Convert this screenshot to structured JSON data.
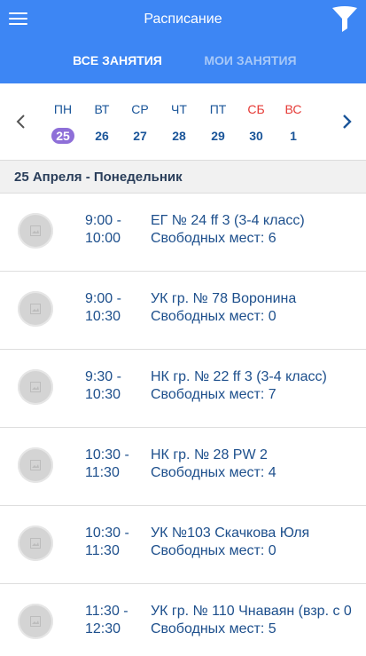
{
  "header": {
    "title": "Расписание",
    "menu_icon": "hamburger-menu-icon",
    "filter_icon": "funnel-filter-icon"
  },
  "tabs": [
    {
      "label": "ВСЕ ЗАНЯТИЯ",
      "active": true
    },
    {
      "label": "МОИ ЗАНЯТИЯ",
      "active": false
    }
  ],
  "week": {
    "days": [
      {
        "name": "ПН",
        "num": "25",
        "selected": true,
        "weekend": false
      },
      {
        "name": "ВТ",
        "num": "26",
        "selected": false,
        "weekend": false
      },
      {
        "name": "СР",
        "num": "27",
        "selected": false,
        "weekend": false
      },
      {
        "name": "ЧТ",
        "num": "28",
        "selected": false,
        "weekend": false
      },
      {
        "name": "ПТ",
        "num": "29",
        "selected": false,
        "weekend": false
      },
      {
        "name": "СБ",
        "num": "30",
        "selected": false,
        "weekend": true
      },
      {
        "name": "ВС",
        "num": "1",
        "selected": false,
        "weekend": true
      }
    ]
  },
  "date_label": "25 Апреля - Понедельник",
  "classes": [
    {
      "start": "9:00 -",
      "end": "10:00",
      "name": "ЕГ № 24 ff 3 (3-4 класс)",
      "seats": "Свободных мест: 6"
    },
    {
      "start": "9:00 -",
      "end": "10:30",
      "name": "УК гр. № 78 Воронина",
      "seats": "Свободных мест: 0"
    },
    {
      "start": "9:30 -",
      "end": "10:30",
      "name": "НК гр. № 22 ff 3 (3-4 класс)",
      "seats": "Свободных мест: 7"
    },
    {
      "start": "10:30 -",
      "end": "11:30",
      "name": "НК гр. № 28 PW 2",
      "seats": "Свободных мест: 4"
    },
    {
      "start": "10:30 -",
      "end": "11:30",
      "name": "УК №103 Скачкова Юля",
      "seats": "Свободных мест: 0"
    },
    {
      "start": "11:30 -",
      "end": "12:30",
      "name": "УК гр. № 110 Чнаваян (взр. с 0",
      "seats": "Свободных мест: 5"
    }
  ],
  "colors": {
    "header": "#3d86f4",
    "selected_day": "#8e6fd8",
    "weekend": "#e53935",
    "text": "#1d4f8c"
  }
}
